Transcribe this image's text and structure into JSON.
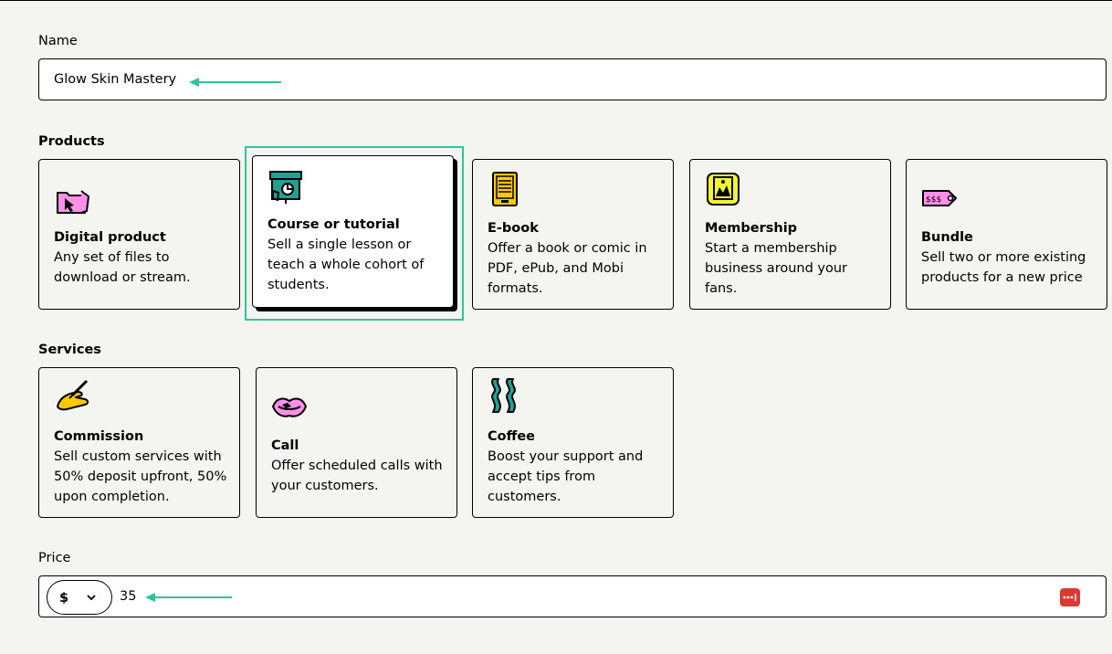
{
  "name_field": {
    "label": "Name",
    "value": "Glow Skin Mastery"
  },
  "products": {
    "label": "Products",
    "items": [
      {
        "title": "Digital product",
        "description": "Any set of files to download or stream.",
        "icon": "folder-cursor-icon"
      },
      {
        "title": "Course or tutorial",
        "description": "Sell a single lesson or teach a whole cohort of students.",
        "icon": "presentation-board-icon",
        "selected": true
      },
      {
        "title": "E-book",
        "description": "Offer a book or comic in PDF, ePub, and Mobi formats.",
        "icon": "ebook-reader-icon"
      },
      {
        "title": "Membership",
        "description": "Start a membership business around your fans.",
        "icon": "membership-card-icon"
      },
      {
        "title": "Bundle",
        "description": "Sell two or more existing products for a new price",
        "icon": "price-tag-icon"
      }
    ]
  },
  "services": {
    "label": "Services",
    "items": [
      {
        "title": "Commission",
        "description": "Sell custom services with 50% deposit upfront, 50% upon completion.",
        "icon": "hand-pen-icon"
      },
      {
        "title": "Call",
        "description": "Offer scheduled calls with your customers.",
        "icon": "lips-phone-icon"
      },
      {
        "title": "Coffee",
        "description": "Boost your support and accept tips from customers.",
        "icon": "coffee-steam-icon"
      }
    ]
  },
  "price_field": {
    "label": "Price",
    "currency": "$",
    "value": "35"
  },
  "colors": {
    "background": "#f4f4f0",
    "accent_highlight": "#2ec4a1",
    "password_icon": "#d93a34"
  }
}
